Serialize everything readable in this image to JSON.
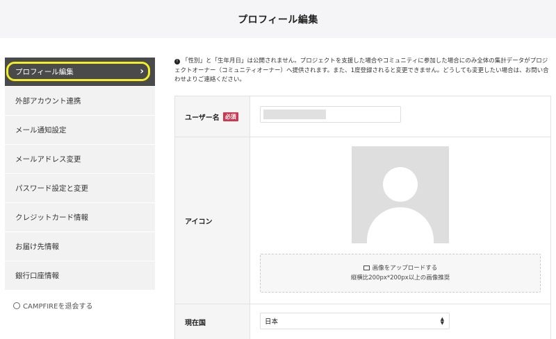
{
  "header": {
    "title": "プロフィール編集"
  },
  "sidebar": {
    "items": [
      {
        "label": "プロフィール編集"
      },
      {
        "label": "外部アカウント連携"
      },
      {
        "label": "メール通知設定"
      },
      {
        "label": "メールアドレス変更"
      },
      {
        "label": "パスワード設定と変更"
      },
      {
        "label": "クレジットカード情報"
      },
      {
        "label": "お届け先情報"
      },
      {
        "label": "銀行口座情報"
      }
    ],
    "withdraw_label": "CAMPFIREを退会する"
  },
  "notice": {
    "text": "「性別」と「生年月日」は公開されません。プロジェクトを支援した場合やコミュニティに参加した場合にのみ全体の集計データがプロジェクトオーナー（コミュニティオーナー）へ提供されます。また、1度登録されると変更できません。どうしても変更したい場合は、お問い合わせよりご連絡ください。"
  },
  "form": {
    "username": {
      "label": "ユーザー名",
      "required_badge": "必須",
      "value": ""
    },
    "icon": {
      "label": "アイコン",
      "upload_label": "画像をアップロードする",
      "upload_hint": "縦横比200px*200px以上の画像推奨"
    },
    "country": {
      "label": "現在国",
      "selected": "日本"
    }
  },
  "colors": {
    "active_bg": "#4a4a4a",
    "highlight": "#f2ee25",
    "required": "#d0364f"
  }
}
